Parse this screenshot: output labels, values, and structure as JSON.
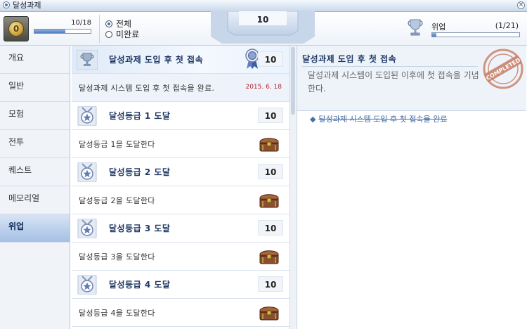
{
  "window": {
    "title": "달성과제"
  },
  "header": {
    "rank_value": "0",
    "progress_text": "10/18",
    "progress_fraction": 0.556,
    "filter_options": [
      {
        "label": "전체",
        "selected": true
      },
      {
        "label": "미완료",
        "selected": false
      }
    ],
    "score": "10",
    "category_label": "위업",
    "category_count": "(1/21)",
    "category_fraction": 0.048
  },
  "sidebar": {
    "items": [
      {
        "label": "개요",
        "active": false
      },
      {
        "label": "일반",
        "active": false
      },
      {
        "label": "모험",
        "active": false
      },
      {
        "label": "전투",
        "active": false
      },
      {
        "label": "퀘스트",
        "active": false
      },
      {
        "label": "메모리얼",
        "active": false
      },
      {
        "label": "위업",
        "active": true
      }
    ]
  },
  "achievements": [
    {
      "title": "달성과제 도입 후 첫 접속",
      "score": "10",
      "description": "달성과제 시스템 도입 후 첫 접속을 완료.",
      "date": "2015. 6. 18",
      "completed": true,
      "icon": "trophy-icon"
    },
    {
      "title": "달성등급 1 도달",
      "score": "10",
      "description": "달성등급 1을 도달한다",
      "completed": false,
      "icon": "medal-icon"
    },
    {
      "title": "달성등급 2 도달",
      "score": "10",
      "description": "달성등급 2을 도달한다",
      "completed": false,
      "icon": "medal-icon"
    },
    {
      "title": "달성등급 3 도달",
      "score": "10",
      "description": "달성등급 3을 도달한다",
      "completed": false,
      "icon": "medal-icon"
    },
    {
      "title": "달성등급 4 도달",
      "score": "10",
      "description": "달성등급 4을 도달한다",
      "completed": false,
      "icon": "medal-icon"
    }
  ],
  "detail": {
    "title": "달성과제 도입 후 첫 접속",
    "description": "달성과제 시스템이 도입된 이후에 첫 접속을 기념한다.",
    "stamp_text": "COMPLETED",
    "objective": "달성과제 시스템 도입 후 첫 접속을 완료"
  },
  "colors": {
    "accent": "#4f7cc0",
    "title_text": "#1e3763",
    "date_red": "#b0252c",
    "stamp": "#c9826a"
  }
}
